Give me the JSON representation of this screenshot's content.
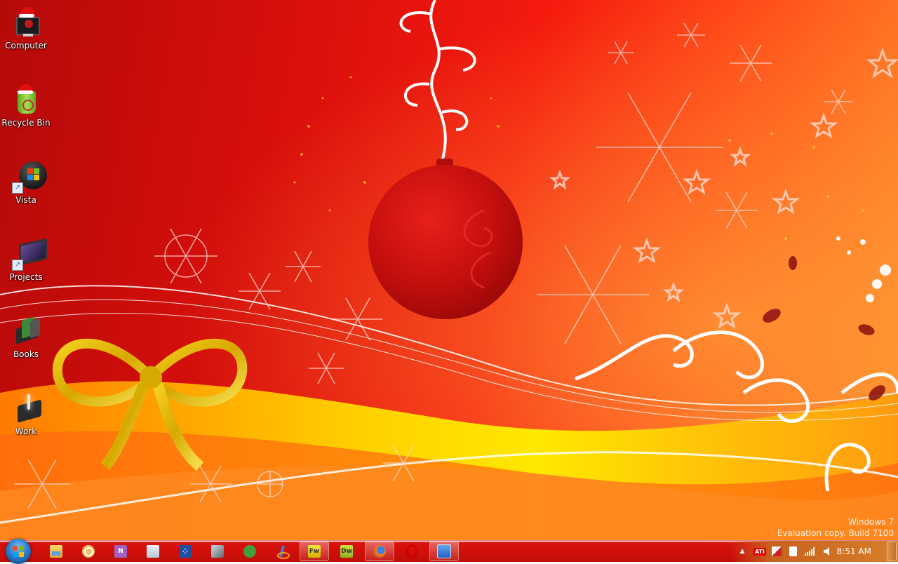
{
  "desktop": {
    "icons": [
      {
        "label": "Computer",
        "icon": "computer-icon"
      },
      {
        "label": "Recycle Bin",
        "icon": "recycle-bin-icon"
      },
      {
        "label": "Vista",
        "icon": "windows-logo-icon",
        "shortcut": true
      },
      {
        "label": "Projects",
        "icon": "photo-frame-icon",
        "shortcut": true
      },
      {
        "label": "Books",
        "icon": "books-icon"
      },
      {
        "label": "Work",
        "icon": "folder-sparkle-icon"
      }
    ],
    "watermark": {
      "line1": "Windows 7",
      "line2": "Evaluation copy. Build 7100"
    }
  },
  "taskbar": {
    "start_label": "Start",
    "pinned": [
      {
        "name": "windows-explorer",
        "icon": "folder-icon",
        "active": false
      },
      {
        "name": "outlook",
        "icon": "mail-clock-icon",
        "active": false
      },
      {
        "name": "onenote",
        "icon": "onenote-icon",
        "active": false
      },
      {
        "name": "notepad",
        "icon": "notepad-icon",
        "active": false
      },
      {
        "name": "blackberry",
        "icon": "blackberry-icon",
        "active": false
      },
      {
        "name": "network-tool",
        "icon": "network-icon",
        "active": false
      },
      {
        "name": "utility",
        "icon": "green-gear-icon",
        "active": false
      },
      {
        "name": "paint-tool",
        "icon": "paint-brush-icon",
        "active": false
      },
      {
        "name": "fireworks",
        "icon": "fireworks-icon",
        "label": "Fw",
        "active": true
      },
      {
        "name": "dreamweaver",
        "icon": "dreamweaver-icon",
        "label": "Dw",
        "active": false
      },
      {
        "name": "firefox",
        "icon": "firefox-icon",
        "active": true
      },
      {
        "name": "opera",
        "icon": "opera-icon",
        "active": false
      },
      {
        "name": "remote-desktop",
        "icon": "remote-desktop-icon",
        "active": true
      }
    ],
    "tray": {
      "show_hidden": "▲",
      "items": [
        {
          "name": "ati",
          "icon": "ati-icon",
          "label": "ATI"
        },
        {
          "name": "kaspersky",
          "icon": "kaspersky-icon"
        },
        {
          "name": "power",
          "icon": "power-plug-icon"
        },
        {
          "name": "network",
          "icon": "signal-bars-icon"
        },
        {
          "name": "volume",
          "icon": "speaker-icon"
        }
      ],
      "clock": "8:51 AM"
    }
  },
  "colors": {
    "taskbar": "#d0100a",
    "wallpaper_dark": "#b50a0a",
    "wallpaper_light": "#ff8a2a"
  }
}
